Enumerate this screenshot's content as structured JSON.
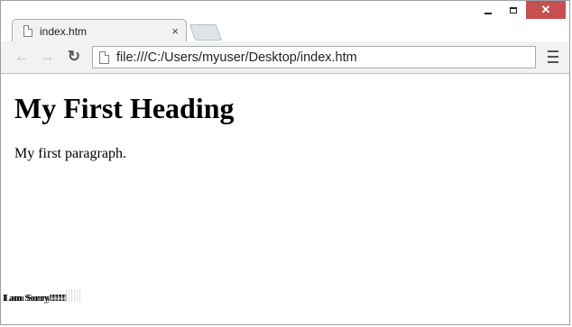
{
  "tab": {
    "title": "index.htm",
    "close_glyph": "×"
  },
  "window_controls": {
    "close_glyph": "✕"
  },
  "toolbar": {
    "back_glyph": "←",
    "forward_glyph": "→",
    "reload_glyph": "↻",
    "address": "file:///C:/Users/myuser/Desktop/index.htm"
  },
  "page": {
    "heading": "My First Heading",
    "paragraph": "My first paragraph.",
    "overlap_text_1": "I am Sorry!!!!!",
    "overlap_text_2": "Lam Sorry!!!!!"
  },
  "icons": {
    "tab_icon": "page-icon",
    "address_icon": "page-icon",
    "menu_icon": "hamburger-icon",
    "minimize_icon": "minimize-icon",
    "maximize_icon": "maximize-icon",
    "close_icon": "close-icon"
  },
  "colors": {
    "close_button": "#c75050",
    "chrome_background": "#f2f2f2",
    "page_background": "#ffffff"
  }
}
